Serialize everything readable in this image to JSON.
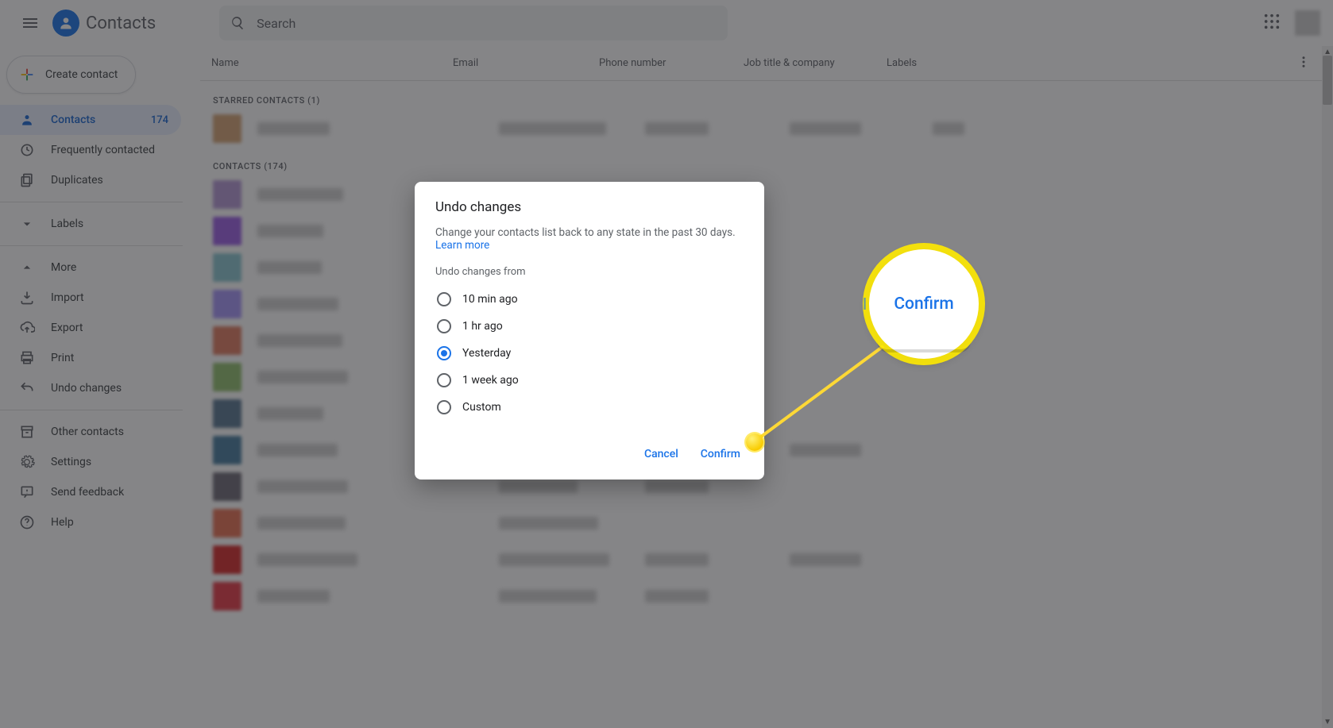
{
  "header": {
    "app_name": "Contacts",
    "search_placeholder": "Search"
  },
  "sidebar": {
    "create_label": "Create contact",
    "items": [
      {
        "label": "Contacts",
        "count": "174"
      },
      {
        "label": "Frequently contacted"
      },
      {
        "label": "Duplicates"
      }
    ],
    "labels_header": "Labels",
    "more": [
      {
        "label": "More"
      },
      {
        "label": "Import"
      },
      {
        "label": "Export"
      },
      {
        "label": "Print"
      },
      {
        "label": "Undo changes"
      }
    ],
    "bottom": [
      {
        "label": "Other contacts"
      },
      {
        "label": "Settings"
      },
      {
        "label": "Send feedback"
      },
      {
        "label": "Help"
      }
    ]
  },
  "columns": {
    "name": "Name",
    "email": "Email",
    "phone": "Phone number",
    "job": "Job title & company",
    "labels": "Labels"
  },
  "sections": {
    "starred": "STARRED CONTACTS (1)",
    "all": "CONTACTS (174)"
  },
  "row_colors": [
    "#d4a373",
    "#b497d6",
    "#9b5de5",
    "#8ac6d1",
    "#a594f9",
    "#e07a5f",
    "#90be6d",
    "#577590",
    "#457b9d",
    "#6d6875",
    "#e76f51",
    "#d62828",
    "#e63946"
  ],
  "dialog": {
    "title": "Undo changes",
    "description": "Change your contacts list back to any state in the past 30 days. ",
    "learn_more": "Learn more",
    "subhead": "Undo changes from",
    "options": [
      {
        "label": "10 min ago",
        "checked": false
      },
      {
        "label": "1 hr ago",
        "checked": false
      },
      {
        "label": "Yesterday",
        "checked": true
      },
      {
        "label": "1 week ago",
        "checked": false
      },
      {
        "label": "Custom",
        "checked": false
      }
    ],
    "cancel": "Cancel",
    "confirm": "Confirm"
  },
  "callout": {
    "label": "Confirm"
  }
}
